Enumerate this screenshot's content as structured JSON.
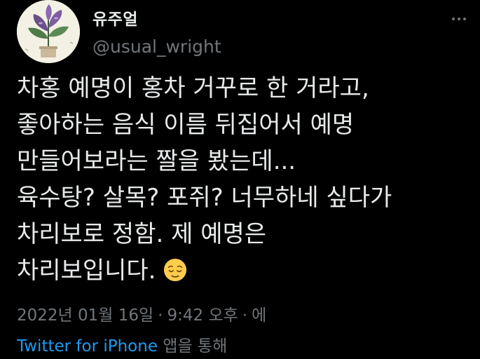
{
  "user": {
    "display_name": "유주얼",
    "handle": "@usual_wright",
    "avatar_icon": "plant-avatar-icon"
  },
  "tweet": {
    "lines": [
      "차홍 예명이 홍차 거꾸로 한 거라고,",
      "좋아하는 음식 이름 뒤집어서 예명",
      "만들어보라는 짤을 봤는데...",
      "육수탕? 살목? 포쥐? 너무하네 싶다가",
      "차리보로 정함. 제 예명은",
      "차리보입니다."
    ],
    "emoji": "relieved-face-icon"
  },
  "meta": {
    "date": "2022년 01월 16일",
    "separator": "·",
    "time": "9:42 오후",
    "separator2": "·",
    "trailing": "에"
  },
  "source": {
    "client": "Twitter for iPhone",
    "suffix": " 앱을 통해"
  },
  "colors": {
    "background": "#000000",
    "text": "#e7e9ea",
    "secondary": "#71767b",
    "link": "#1d9bf0",
    "emoji": "#ffcc4d"
  }
}
